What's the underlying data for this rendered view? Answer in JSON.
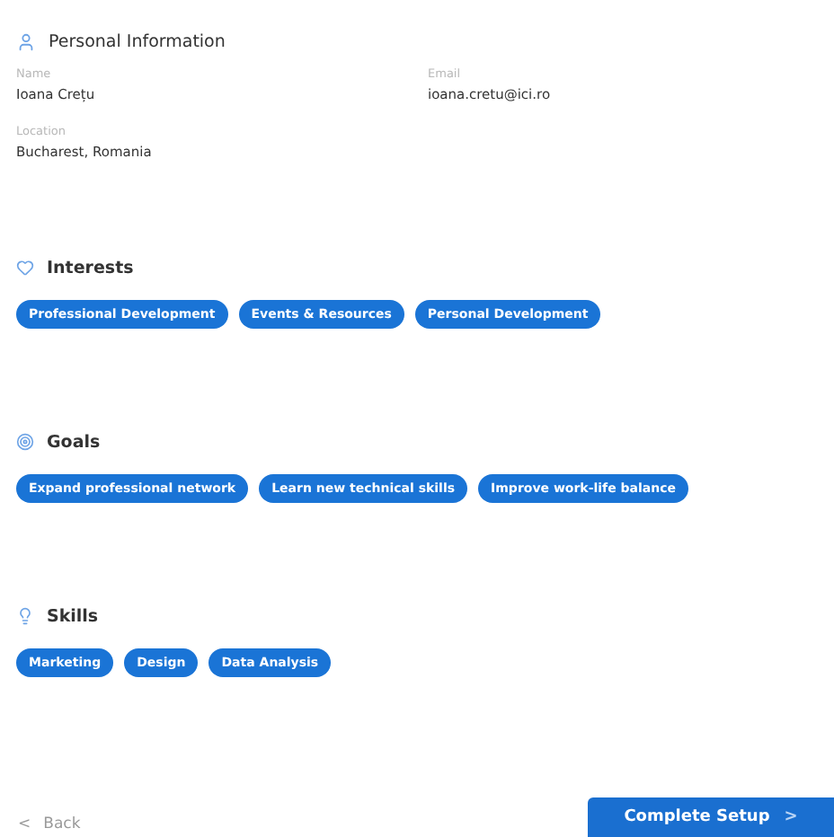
{
  "personal": {
    "title": "Personal Information",
    "fields": [
      {
        "label": "Name",
        "value": "Ioana Crețu"
      },
      {
        "label": "Email",
        "value": "ioana.cretu@ici.ro"
      },
      {
        "label": "Location",
        "value": "Bucharest, Romania"
      }
    ]
  },
  "sections": [
    {
      "kind": "interests",
      "title": "Interests",
      "tags": [
        "Professional Development",
        "Events & Resources",
        "Personal Development"
      ]
    },
    {
      "kind": "goals",
      "title": "Goals",
      "tags": [
        "Expand professional network",
        "Learn new technical skills",
        "Improve work-life balance"
      ]
    },
    {
      "kind": "skills",
      "title": "Skills",
      "tags": [
        "Marketing",
        "Design",
        "Data Analysis"
      ]
    }
  ],
  "footer": {
    "back": "Back",
    "back_icon": "<",
    "submit": "Complete Setup",
    "submit_icon": ">"
  }
}
